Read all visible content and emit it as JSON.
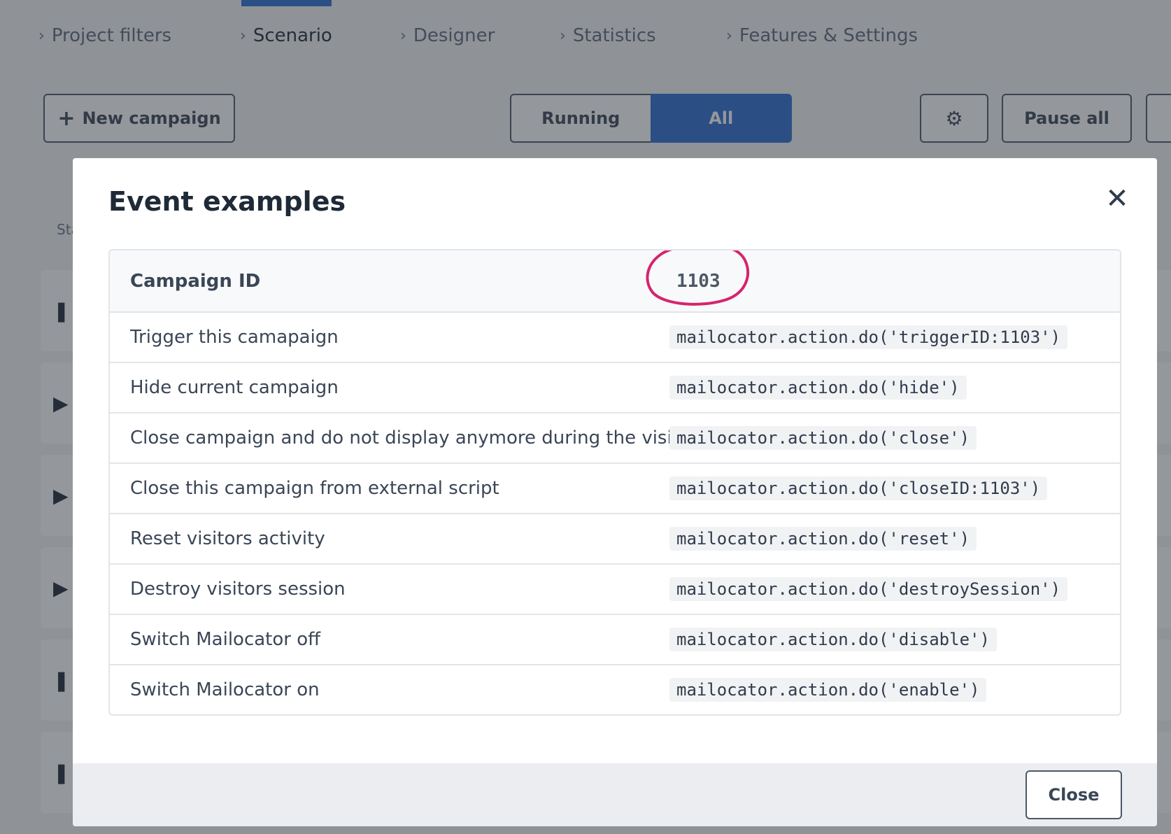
{
  "nav": {
    "items": [
      {
        "label": "Project filters"
      },
      {
        "label": "Scenario"
      },
      {
        "label": "Designer"
      },
      {
        "label": "Statistics"
      },
      {
        "label": "Features & Settings"
      }
    ]
  },
  "toolbar": {
    "new_campaign_label": "New campaign",
    "filter_running_label": "Running",
    "filter_all_label": "All",
    "pause_all_label": "Pause all"
  },
  "list": {
    "column_label_partial": "Sta"
  },
  "modal": {
    "title": "Event examples",
    "close_label": "Close",
    "header": {
      "label": "Campaign ID",
      "value": "1103"
    },
    "rows": [
      {
        "label": "Trigger this camapaign",
        "code": "mailocator.action.do('triggerID:1103')"
      },
      {
        "label": "Hide current campaign",
        "code": "mailocator.action.do('hide')"
      },
      {
        "label": "Close campaign and do not display anymore during the visit",
        "code": "mailocator.action.do('close')"
      },
      {
        "label": "Close this campaign from external script",
        "code": "mailocator.action.do('closeID:1103')"
      },
      {
        "label": "Reset visitors activity",
        "code": "mailocator.action.do('reset')"
      },
      {
        "label": "Destroy visitors session",
        "code": "mailocator.action.do('destroySession')"
      },
      {
        "label": "Switch Mailocator off",
        "code": "mailocator.action.do('disable')"
      },
      {
        "label": "Switch Mailocator on",
        "code": "mailocator.action.do('enable')"
      }
    ]
  },
  "colors": {
    "accent": "#2d6fd1",
    "highlight_circle": "#d6246e"
  }
}
